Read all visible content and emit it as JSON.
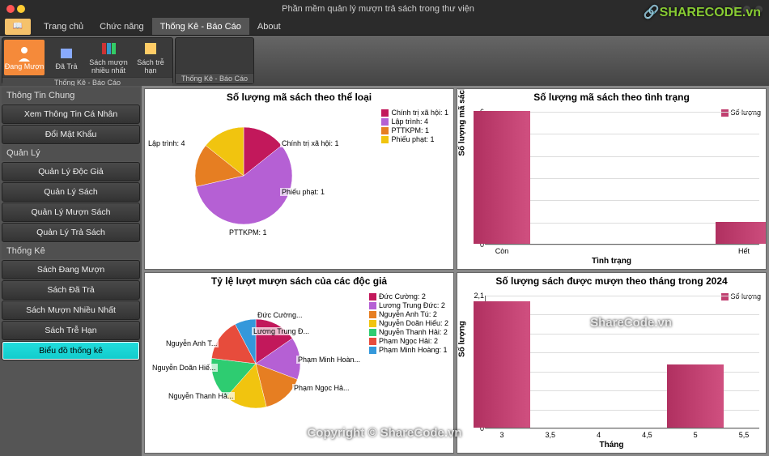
{
  "window": {
    "title": "Phần mềm quản lý mượn trả sách trong thư viện"
  },
  "ribbon": {
    "tabs": [
      "Trang chủ",
      "Chức năng",
      "Thống Kê - Báo Cáo",
      "About"
    ],
    "active_index": 2,
    "group_label_1": "Thống Kê - Báo Cáo",
    "group_label_2": "Thống Kê - Báo Cáo",
    "tools": {
      "dang_muon": "Đang Mượn",
      "da_tra": "Đã Trả",
      "sach_muon_nhieu": "Sách mượn nhiều nhất",
      "sach_tre_han": "Sách trễ hạn"
    }
  },
  "sidebar": {
    "sections": {
      "thong_tin": {
        "header": "Thông Tin Chung",
        "items": [
          "Xem Thông Tin Cá Nhân",
          "Đổi Mật Khẩu"
        ]
      },
      "quan_ly": {
        "header": "Quản Lý",
        "items": [
          "Quản Lý Độc Giả",
          "Quản Lý Sách",
          "Quản Lý Mượn Sách",
          "Quản Lý Trả Sách"
        ]
      },
      "thong_ke": {
        "header": "Thống Kê",
        "items": [
          "Sách Đang Mượn",
          "Sách Đã Trả",
          "Sách Mượn Nhiều Nhất",
          "Sách Trễ Hạn",
          "Biểu đồ thống kê"
        ]
      }
    }
  },
  "chart_data": [
    {
      "id": "pie1",
      "type": "pie",
      "title": "Số lượng mã sách theo thể loại",
      "series": [
        {
          "name": "Chính trị xã hội",
          "value": 1,
          "label": "Chính trị xã hội: 1",
          "color": "#c2185b"
        },
        {
          "name": "Lập trình",
          "value": 4,
          "label": "Lập trình: 4",
          "color": "#b560d4"
        },
        {
          "name": "PTTKPM",
          "value": 1,
          "label": "PTTKPM: 1",
          "color": "#e67e22"
        },
        {
          "name": "Phiếu phạt",
          "value": 1,
          "label": "Phiếu phạt: 1",
          "color": "#f1c40f"
        }
      ]
    },
    {
      "id": "bar1",
      "type": "bar",
      "title": "Số lượng mã sách theo tình trạng",
      "xlabel": "Tình trạng",
      "ylabel": "Số lượng mã sách",
      "legend": "Số lượng",
      "categories": [
        "Còn",
        "Hết"
      ],
      "values": [
        6,
        1
      ],
      "ylim": [
        0,
        6
      ],
      "yticks": [
        0,
        1,
        2,
        3,
        4,
        5,
        6
      ]
    },
    {
      "id": "pie2",
      "type": "pie",
      "title": "Tỷ lệ lượt mượn sách của các độc giả",
      "series": [
        {
          "name": "Đức Cường",
          "value": 2,
          "label": "Đức Cường: 2",
          "short": "Đức Cường...",
          "color": "#c2185b"
        },
        {
          "name": "Lương Trung Đức",
          "value": 2,
          "label": "Lương Trung Đức: 2",
          "short": "Lương Trung Đ...",
          "color": "#b560d4"
        },
        {
          "name": "Nguyễn Anh Tú",
          "value": 2,
          "label": "Nguyễn Anh Tú: 2",
          "short": "Nguyễn Anh T...",
          "color": "#e67e22"
        },
        {
          "name": "Nguyễn Doãn Hiếu",
          "value": 2,
          "label": "Nguyễn Doãn Hiếu: 2",
          "short": "Nguyễn Doãn Hiế...",
          "color": "#f1c40f"
        },
        {
          "name": "Nguyễn Thanh Hải",
          "value": 2,
          "label": "Nguyễn Thanh Hải: 2",
          "short": "Nguyễn Thanh Hả...",
          "color": "#2ecc71"
        },
        {
          "name": "Phạm Ngọc Hải",
          "value": 2,
          "label": "Phạm Ngọc Hải: 2",
          "short": "Phạm Ngọc Hả...",
          "color": "#e74c3c"
        },
        {
          "name": "Phạm Minh Hoàng",
          "value": 1,
          "label": "Phạm Minh Hoàng: 1",
          "short": "Phạm Minh Hoàn...",
          "color": "#3498db"
        }
      ]
    },
    {
      "id": "bar2",
      "type": "bar",
      "title": "Số lượng sách được mượn theo tháng trong 2024",
      "xlabel": "Tháng",
      "ylabel": "Số lượng",
      "legend": "Số lượng",
      "categories": [
        3,
        5
      ],
      "values": [
        2,
        1
      ],
      "ylim": [
        0,
        2.1
      ],
      "yticks": [
        0,
        0.3,
        0.6,
        0.9,
        1.2,
        1.5,
        1.8,
        2.1
      ],
      "xticks": [
        3,
        3.5,
        4,
        4.5,
        5,
        5.5
      ]
    }
  ],
  "watermarks": {
    "logo": "SHARECODE.vn",
    "copyright": "Copyright © ShareCode.vn",
    "mid": "ShareCode.vn"
  }
}
